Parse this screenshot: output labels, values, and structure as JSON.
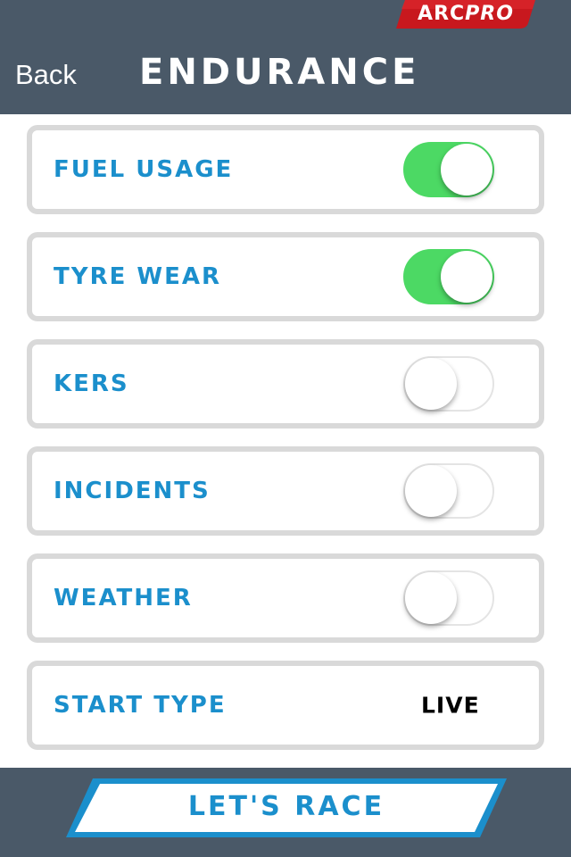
{
  "header": {
    "logo_primary": "ARC",
    "logo_secondary": "PRO",
    "back_label": "Back",
    "title": "ENDURANCE"
  },
  "rows": [
    {
      "label": "FUEL USAGE",
      "type": "toggle",
      "enabled": true
    },
    {
      "label": "TYRE WEAR",
      "type": "toggle",
      "enabled": true
    },
    {
      "label": "KERS",
      "type": "toggle",
      "enabled": false
    },
    {
      "label": "INCIDENTS",
      "type": "toggle",
      "enabled": false
    },
    {
      "label": "WEATHER",
      "type": "toggle",
      "enabled": false
    },
    {
      "label": "START TYPE",
      "type": "value",
      "value": "LIVE"
    }
  ],
  "footer": {
    "race_label": "LET'S RACE"
  },
  "colors": {
    "header_bg": "#4a5968",
    "accent_blue": "#1b8fcc",
    "toggle_on": "#4cd964",
    "logo_red": "#c8181e"
  }
}
